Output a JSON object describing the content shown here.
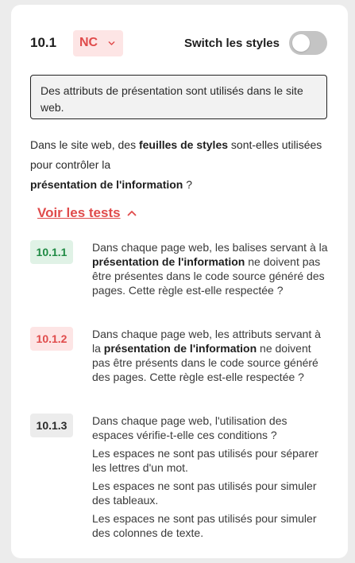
{
  "criterion": {
    "number": "10.1",
    "status": "NC",
    "colors": {
      "nc_bg": "#fde5e5",
      "nc_text": "#e04b4b",
      "c_bg": "#e0f2e6",
      "c_text": "#1f8a44",
      "na_bg": "#ececec"
    }
  },
  "switch": {
    "label": "Switch les styles",
    "on": false
  },
  "callout": {
    "text": "Des attributs de présentation sont utilisés dans le site web."
  },
  "question": {
    "part1": "Dans le site web, des ",
    "bold1": "feuilles de styles",
    "part2": " sont-elles utilisées pour contrôler la",
    "bold2": "présentation de l'information",
    "part3": " ?"
  },
  "tests_link": {
    "label": "Voir les tests",
    "icon": "chevron-up-icon"
  },
  "tests": [
    {
      "id": "10.1.1",
      "status": "C",
      "pre": "Dans chaque page web, les balises servant à la ",
      "bold": "présentation de l'information",
      "post": " ne doivent pas être présentes dans le code source généré des pages. Cette règle est-elle respectée ?"
    },
    {
      "id": "10.1.2",
      "status": "NC",
      "pre": "Dans chaque page web, les attributs servant à la ",
      "bold": "présentation de l'information",
      "post": " ne doivent pas être présents dans le code source généré des pages. Cette règle est-elle respectée ?"
    },
    {
      "id": "10.1.3",
      "status": "NT",
      "intro": "Dans chaque page web, l'utilisation des espaces vérifie-t-elle ces conditions ?",
      "conditions": [
        "Les espaces ne sont pas utilisés pour séparer les lettres d'un mot.",
        "Les espaces ne sont pas utilisés pour simuler des tableaux.",
        "Les espaces ne sont pas utilisés pour simuler des colonnes de texte."
      ]
    }
  ]
}
